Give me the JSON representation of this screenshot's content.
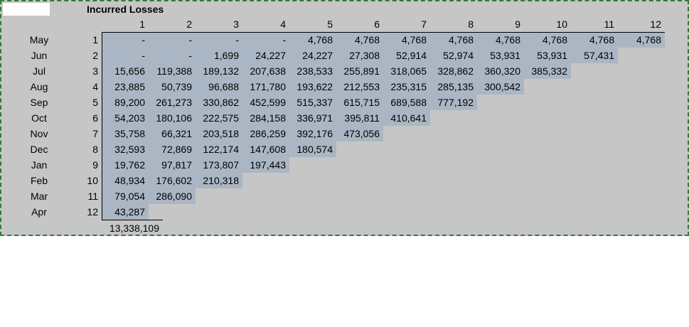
{
  "title": "Incurred Losses",
  "dev_headers": [
    "1",
    "2",
    "3",
    "4",
    "5",
    "6",
    "7",
    "8",
    "9",
    "10",
    "11",
    "12"
  ],
  "rows": [
    {
      "month": "May",
      "idx": "1",
      "values": [
        "-",
        "-",
        "-",
        "-",
        "4,768",
        "4,768",
        "4,768",
        "4,768",
        "4,768",
        "4,768",
        "4,768",
        "4,768"
      ]
    },
    {
      "month": "Jun",
      "idx": "2",
      "values": [
        "-",
        "-",
        "1,699",
        "24,227",
        "24,227",
        "27,308",
        "52,914",
        "52,974",
        "53,931",
        "53,931",
        "57,431"
      ]
    },
    {
      "month": "Jul",
      "idx": "3",
      "values": [
        "15,656",
        "119,388",
        "189,132",
        "207,638",
        "238,533",
        "255,891",
        "318,065",
        "328,862",
        "360,320",
        "385,332"
      ]
    },
    {
      "month": "Aug",
      "idx": "4",
      "values": [
        "23,885",
        "50,739",
        "96,688",
        "171,780",
        "193,622",
        "212,553",
        "235,315",
        "285,135",
        "300,542"
      ]
    },
    {
      "month": "Sep",
      "idx": "5",
      "values": [
        "89,200",
        "261,273",
        "330,862",
        "452,599",
        "515,337",
        "615,715",
        "689,588",
        "777,192"
      ]
    },
    {
      "month": "Oct",
      "idx": "6",
      "values": [
        "54,203",
        "180,106",
        "222,575",
        "284,158",
        "336,971",
        "395,811",
        "410,641"
      ]
    },
    {
      "month": "Nov",
      "idx": "7",
      "values": [
        "35,758",
        "66,321",
        "203,518",
        "286,259",
        "392,176",
        "473,056"
      ]
    },
    {
      "month": "Dec",
      "idx": "8",
      "values": [
        "32,593",
        "72,869",
        "122,174",
        "147,608",
        "180,574"
      ]
    },
    {
      "month": "Jan",
      "idx": "9",
      "values": [
        "19,762",
        "97,817",
        "173,807",
        "197,443"
      ]
    },
    {
      "month": "Feb",
      "idx": "10",
      "values": [
        "48,934",
        "176,602",
        "210,318"
      ]
    },
    {
      "month": "Mar",
      "idx": "11",
      "values": [
        "79,054",
        "286,090"
      ]
    },
    {
      "month": "Apr",
      "idx": "12",
      "values": [
        "43,287"
      ]
    }
  ],
  "total": "13,338,109",
  "colors": {
    "sheet": "#c6c6c6",
    "triangle": "#aab6c3",
    "marquee": "#2e7d32"
  }
}
